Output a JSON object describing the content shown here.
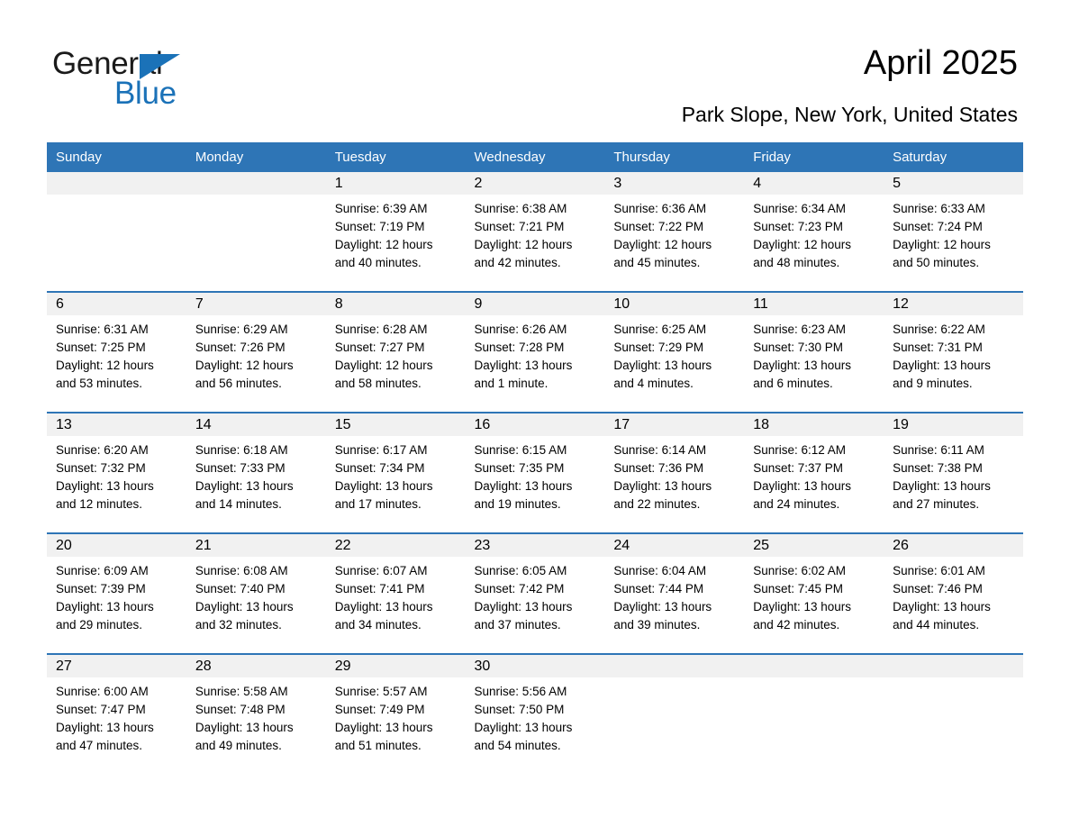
{
  "brand": {
    "name_part1": "General",
    "name_part2": "Blue",
    "accent_color": "#1b72b8",
    "triangle_icon": "triangle-icon"
  },
  "header": {
    "title": "April 2025",
    "location": "Park Slope, New York, United States"
  },
  "calendar": {
    "header_bg": "#2e75b6",
    "daynum_bg": "#f1f1f1",
    "weekday_headers": [
      "Sunday",
      "Monday",
      "Tuesday",
      "Wednesday",
      "Thursday",
      "Friday",
      "Saturday"
    ],
    "weeks": [
      [
        {
          "day": "",
          "empty": true
        },
        {
          "day": "",
          "empty": true
        },
        {
          "day": "1",
          "sunrise": "Sunrise: 6:39 AM",
          "sunset": "Sunset: 7:19 PM",
          "daylight_l1": "Daylight: 12 hours",
          "daylight_l2": "and 40 minutes."
        },
        {
          "day": "2",
          "sunrise": "Sunrise: 6:38 AM",
          "sunset": "Sunset: 7:21 PM",
          "daylight_l1": "Daylight: 12 hours",
          "daylight_l2": "and 42 minutes."
        },
        {
          "day": "3",
          "sunrise": "Sunrise: 6:36 AM",
          "sunset": "Sunset: 7:22 PM",
          "daylight_l1": "Daylight: 12 hours",
          "daylight_l2": "and 45 minutes."
        },
        {
          "day": "4",
          "sunrise": "Sunrise: 6:34 AM",
          "sunset": "Sunset: 7:23 PM",
          "daylight_l1": "Daylight: 12 hours",
          "daylight_l2": "and 48 minutes."
        },
        {
          "day": "5",
          "sunrise": "Sunrise: 6:33 AM",
          "sunset": "Sunset: 7:24 PM",
          "daylight_l1": "Daylight: 12 hours",
          "daylight_l2": "and 50 minutes."
        }
      ],
      [
        {
          "day": "6",
          "sunrise": "Sunrise: 6:31 AM",
          "sunset": "Sunset: 7:25 PM",
          "daylight_l1": "Daylight: 12 hours",
          "daylight_l2": "and 53 minutes."
        },
        {
          "day": "7",
          "sunrise": "Sunrise: 6:29 AM",
          "sunset": "Sunset: 7:26 PM",
          "daylight_l1": "Daylight: 12 hours",
          "daylight_l2": "and 56 minutes."
        },
        {
          "day": "8",
          "sunrise": "Sunrise: 6:28 AM",
          "sunset": "Sunset: 7:27 PM",
          "daylight_l1": "Daylight: 12 hours",
          "daylight_l2": "and 58 minutes."
        },
        {
          "day": "9",
          "sunrise": "Sunrise: 6:26 AM",
          "sunset": "Sunset: 7:28 PM",
          "daylight_l1": "Daylight: 13 hours",
          "daylight_l2": "and 1 minute."
        },
        {
          "day": "10",
          "sunrise": "Sunrise: 6:25 AM",
          "sunset": "Sunset: 7:29 PM",
          "daylight_l1": "Daylight: 13 hours",
          "daylight_l2": "and 4 minutes."
        },
        {
          "day": "11",
          "sunrise": "Sunrise: 6:23 AM",
          "sunset": "Sunset: 7:30 PM",
          "daylight_l1": "Daylight: 13 hours",
          "daylight_l2": "and 6 minutes."
        },
        {
          "day": "12",
          "sunrise": "Sunrise: 6:22 AM",
          "sunset": "Sunset: 7:31 PM",
          "daylight_l1": "Daylight: 13 hours",
          "daylight_l2": "and 9 minutes."
        }
      ],
      [
        {
          "day": "13",
          "sunrise": "Sunrise: 6:20 AM",
          "sunset": "Sunset: 7:32 PM",
          "daylight_l1": "Daylight: 13 hours",
          "daylight_l2": "and 12 minutes."
        },
        {
          "day": "14",
          "sunrise": "Sunrise: 6:18 AM",
          "sunset": "Sunset: 7:33 PM",
          "daylight_l1": "Daylight: 13 hours",
          "daylight_l2": "and 14 minutes."
        },
        {
          "day": "15",
          "sunrise": "Sunrise: 6:17 AM",
          "sunset": "Sunset: 7:34 PM",
          "daylight_l1": "Daylight: 13 hours",
          "daylight_l2": "and 17 minutes."
        },
        {
          "day": "16",
          "sunrise": "Sunrise: 6:15 AM",
          "sunset": "Sunset: 7:35 PM",
          "daylight_l1": "Daylight: 13 hours",
          "daylight_l2": "and 19 minutes."
        },
        {
          "day": "17",
          "sunrise": "Sunrise: 6:14 AM",
          "sunset": "Sunset: 7:36 PM",
          "daylight_l1": "Daylight: 13 hours",
          "daylight_l2": "and 22 minutes."
        },
        {
          "day": "18",
          "sunrise": "Sunrise: 6:12 AM",
          "sunset": "Sunset: 7:37 PM",
          "daylight_l1": "Daylight: 13 hours",
          "daylight_l2": "and 24 minutes."
        },
        {
          "day": "19",
          "sunrise": "Sunrise: 6:11 AM",
          "sunset": "Sunset: 7:38 PM",
          "daylight_l1": "Daylight: 13 hours",
          "daylight_l2": "and 27 minutes."
        }
      ],
      [
        {
          "day": "20",
          "sunrise": "Sunrise: 6:09 AM",
          "sunset": "Sunset: 7:39 PM",
          "daylight_l1": "Daylight: 13 hours",
          "daylight_l2": "and 29 minutes."
        },
        {
          "day": "21",
          "sunrise": "Sunrise: 6:08 AM",
          "sunset": "Sunset: 7:40 PM",
          "daylight_l1": "Daylight: 13 hours",
          "daylight_l2": "and 32 minutes."
        },
        {
          "day": "22",
          "sunrise": "Sunrise: 6:07 AM",
          "sunset": "Sunset: 7:41 PM",
          "daylight_l1": "Daylight: 13 hours",
          "daylight_l2": "and 34 minutes."
        },
        {
          "day": "23",
          "sunrise": "Sunrise: 6:05 AM",
          "sunset": "Sunset: 7:42 PM",
          "daylight_l1": "Daylight: 13 hours",
          "daylight_l2": "and 37 minutes."
        },
        {
          "day": "24",
          "sunrise": "Sunrise: 6:04 AM",
          "sunset": "Sunset: 7:44 PM",
          "daylight_l1": "Daylight: 13 hours",
          "daylight_l2": "and 39 minutes."
        },
        {
          "day": "25",
          "sunrise": "Sunrise: 6:02 AM",
          "sunset": "Sunset: 7:45 PM",
          "daylight_l1": "Daylight: 13 hours",
          "daylight_l2": "and 42 minutes."
        },
        {
          "day": "26",
          "sunrise": "Sunrise: 6:01 AM",
          "sunset": "Sunset: 7:46 PM",
          "daylight_l1": "Daylight: 13 hours",
          "daylight_l2": "and 44 minutes."
        }
      ],
      [
        {
          "day": "27",
          "sunrise": "Sunrise: 6:00 AM",
          "sunset": "Sunset: 7:47 PM",
          "daylight_l1": "Daylight: 13 hours",
          "daylight_l2": "and 47 minutes."
        },
        {
          "day": "28",
          "sunrise": "Sunrise: 5:58 AM",
          "sunset": "Sunset: 7:48 PM",
          "daylight_l1": "Daylight: 13 hours",
          "daylight_l2": "and 49 minutes."
        },
        {
          "day": "29",
          "sunrise": "Sunrise: 5:57 AM",
          "sunset": "Sunset: 7:49 PM",
          "daylight_l1": "Daylight: 13 hours",
          "daylight_l2": "and 51 minutes."
        },
        {
          "day": "30",
          "sunrise": "Sunrise: 5:56 AM",
          "sunset": "Sunset: 7:50 PM",
          "daylight_l1": "Daylight: 13 hours",
          "daylight_l2": "and 54 minutes."
        },
        {
          "day": "",
          "empty": true
        },
        {
          "day": "",
          "empty": true
        },
        {
          "day": "",
          "empty": true
        }
      ]
    ]
  }
}
